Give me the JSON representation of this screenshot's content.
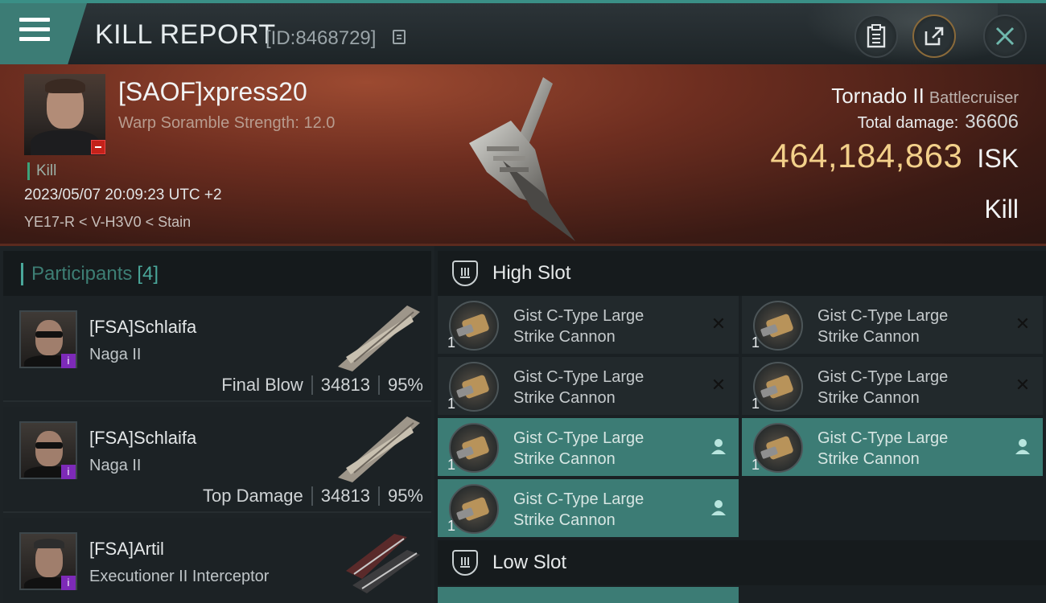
{
  "header": {
    "title": "KILL REPORT",
    "report_id": "[ID:8468729]",
    "icons": {
      "menu": "hamburger-icon",
      "copy": "copy-icon",
      "clipboard": "clipboard-icon",
      "share": "share-icon",
      "close": "close-icon"
    }
  },
  "victim": {
    "name": "[SAOF]xpress20",
    "scramble": "Warp Soramble Strength: 12.0",
    "kill_tag": "Kill",
    "datetime": "2023/05/07 20:09:23 UTC +2",
    "location": "YE17-R < V-H3V0 < Stain",
    "ship_name": "Tornado II",
    "ship_class": "Battlecruiser",
    "total_damage_label": "Total damage:",
    "total_damage": "36606",
    "isk_value": "464,184,863",
    "isk_unit": "ISK",
    "result": "Kill"
  },
  "participants": {
    "label": "Participants",
    "count": "[4]",
    "rows": [
      {
        "name": "[FSA]Schlaifa",
        "ship": "Naga II",
        "role": "Final Blow",
        "damage": "34813",
        "percent": "95%"
      },
      {
        "name": "[FSA]Schlaifa",
        "ship": "Naga II",
        "role": "Top Damage",
        "damage": "34813",
        "percent": "95%"
      },
      {
        "name": "[FSA]Artil",
        "ship": "Executioner II Interceptor"
      }
    ]
  },
  "slots": {
    "high_label": "High Slot",
    "low_label": "Low Slot",
    "modules": [
      {
        "line1": "Gist C-Type Large",
        "line2": "Strike Cannon",
        "qty": "1",
        "status": "destroyed"
      },
      {
        "line1": "Gist C-Type Large",
        "line2": "Strike Cannon",
        "qty": "1",
        "status": "destroyed"
      },
      {
        "line1": "Gist C-Type Large",
        "line2": "Strike Cannon",
        "qty": "1",
        "status": "destroyed"
      },
      {
        "line1": "Gist C-Type Large",
        "line2": "Strike Cannon",
        "qty": "1",
        "status": "destroyed"
      },
      {
        "line1": "Gist C-Type Large",
        "line2": "Strike Cannon",
        "qty": "1",
        "status": "dropped"
      },
      {
        "line1": "Gist C-Type Large",
        "line2": "Strike Cannon",
        "qty": "1",
        "status": "dropped"
      },
      {
        "line1": "Gist C-Type Large",
        "line2": "Strike Cannon",
        "qty": "1",
        "status": "dropped"
      }
    ]
  },
  "colors": {
    "accent": "#3c7c75",
    "isk": "#f3d08a",
    "banner": "#6e2e20",
    "badge_red": "#c4221a",
    "badge_purple": "#7d2ab8"
  }
}
